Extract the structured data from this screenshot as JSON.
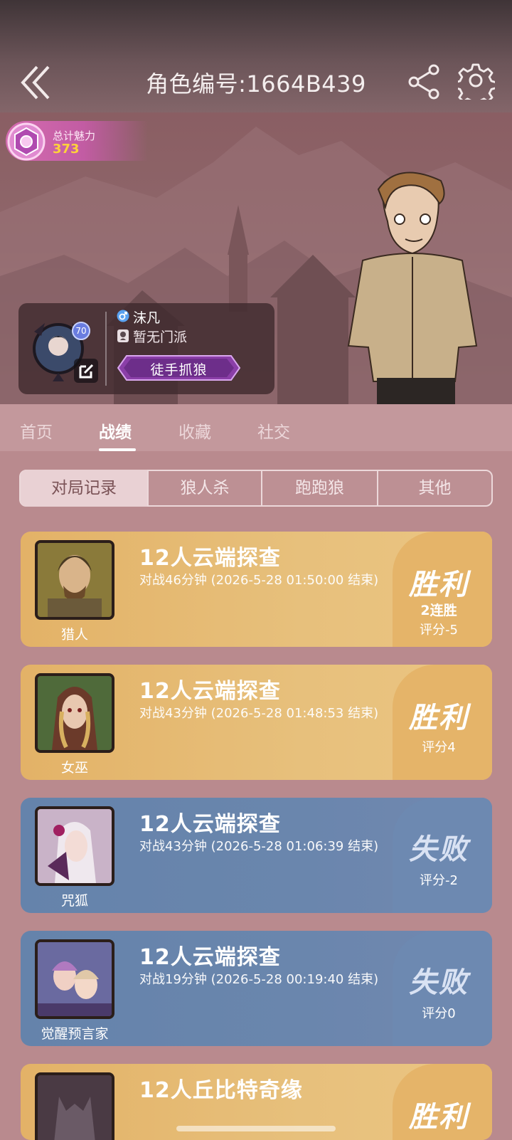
{
  "header": {
    "title": "角色编号:1664B439",
    "back_icon": "double-chevron-left-icon",
    "share_icon": "share-icon",
    "settings_icon": "gear-icon"
  },
  "charm": {
    "label": "总计魅力",
    "value": "373"
  },
  "profile": {
    "level": "70",
    "nickname": "沫凡",
    "gender": "male",
    "faction": "暂无门派",
    "title_badge": "徒手抓狼"
  },
  "tabs": [
    {
      "label": "首页",
      "active": false
    },
    {
      "label": "战绩",
      "active": true
    },
    {
      "label": "收藏",
      "active": false
    },
    {
      "label": "社交",
      "active": false
    }
  ],
  "segments": [
    {
      "label": "对局记录",
      "active": true
    },
    {
      "label": "狼人杀",
      "active": false
    },
    {
      "label": "跑跑狼",
      "active": false
    },
    {
      "label": "其他",
      "active": false
    }
  ],
  "records": [
    {
      "role": "猎人",
      "mode": "12人云端探查",
      "duration": "对战46分钟 (2026-5-28 01:50:00 结束)",
      "result": "胜利",
      "streak": "2连胜",
      "score": "评分-5",
      "outcome": "win"
    },
    {
      "role": "女巫",
      "mode": "12人云端探查",
      "duration": "对战43分钟 (2026-5-28 01:48:53 结束)",
      "result": "胜利",
      "streak": "",
      "score": "评分4",
      "outcome": "win"
    },
    {
      "role": "咒狐",
      "mode": "12人云端探查",
      "duration": "对战43分钟 (2026-5-28 01:06:39 结束)",
      "result": "失败",
      "streak": "",
      "score": "评分-2",
      "outcome": "lose"
    },
    {
      "role": "觉醒预言家",
      "mode": "12人云端探查",
      "duration": "对战19分钟 (2026-5-28 00:19:40 结束)",
      "result": "失败",
      "streak": "",
      "score": "评分0",
      "outcome": "lose"
    },
    {
      "role": "",
      "mode": "12人丘比特奇缘",
      "duration": "",
      "result": "胜利",
      "streak": "",
      "score": "",
      "outcome": "win"
    }
  ],
  "colors": {
    "win": "#e5b469",
    "lose": "#6d89b1",
    "background": "#b98a8e",
    "charm_value": "#ffd23a"
  }
}
